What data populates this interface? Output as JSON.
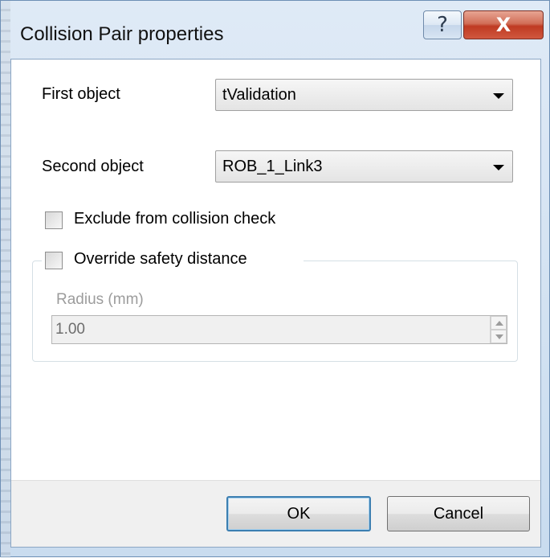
{
  "dialog": {
    "title": "Collision Pair properties",
    "help_glyph": "?",
    "close_glyph": "X"
  },
  "form": {
    "first_object_label": "First object",
    "first_object_value": "tValidation",
    "second_object_label": "Second object",
    "second_object_value": "ROB_1_Link3",
    "exclude_label": "Exclude from collision check",
    "exclude_checked": false,
    "override_label": "Override safety distance",
    "override_checked": false,
    "radius_label": "Radius (mm)",
    "radius_value": "1.00"
  },
  "buttons": {
    "ok_label": "OK",
    "cancel_label": "Cancel"
  },
  "icons": {
    "help": "help-icon",
    "close": "close-icon",
    "dropdown": "chevron-down-icon",
    "spin_up": "spin-up-icon",
    "spin_down": "spin-down-icon"
  },
  "colors": {
    "close_button": "#c7402a",
    "default_button_border": "#3c7fb1",
    "disabled_text": "#9c9c9c"
  }
}
